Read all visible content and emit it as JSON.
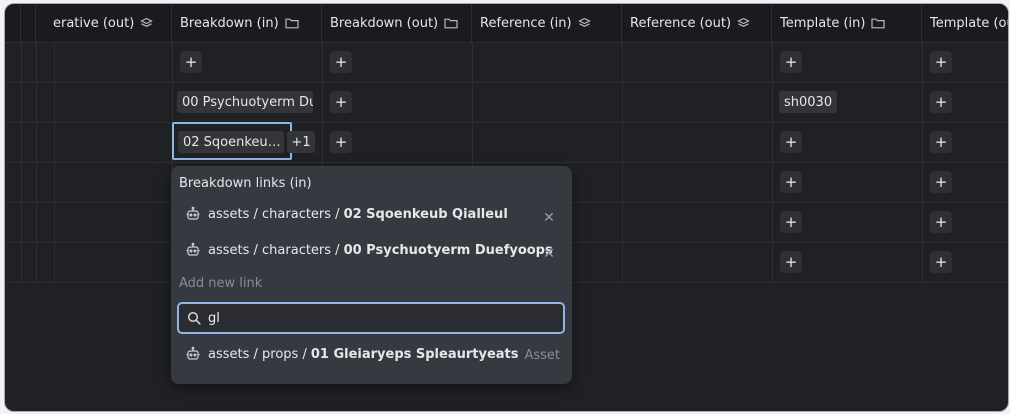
{
  "columns": [
    {
      "label": "erative (out)",
      "icon": "stack-icon"
    },
    {
      "label": "Breakdown (in)",
      "icon": "folder-icon"
    },
    {
      "label": "Breakdown (out)",
      "icon": "folder-icon"
    },
    {
      "label": "Reference (in)",
      "icon": "stack-icon"
    },
    {
      "label": "Reference (out)",
      "icon": "stack-icon"
    },
    {
      "label": "Template (in)",
      "icon": "folder-icon"
    },
    {
      "label": "Template (ou",
      "icon": "none"
    }
  ],
  "cells": {
    "add_symbol": "+",
    "row2_breakdown_in": "00 Psychuotyerm Du",
    "row2_template_in": "sh0030",
    "row3_breakdown_in": "02 Sqoenkeu…",
    "row3_more_count": "+1"
  },
  "popup": {
    "title": "Breakdown links (in)",
    "links": [
      {
        "path": "assets / characters /",
        "name": "02 Sqoenkeub Qialleul",
        "icon": "asset-icon"
      },
      {
        "path": "assets / characters /",
        "name": "00 Psychuotyerm Duefyoops",
        "icon": "asset-icon"
      }
    ],
    "remove_symbol": "✕",
    "add_label": "Add new link",
    "search": {
      "value": "gl",
      "placeholder": ""
    },
    "results": [
      {
        "path": "assets / props /",
        "name": "01 Gleiaryeps Spleaurtyeats",
        "type": "Asset",
        "icon": "asset-icon"
      }
    ]
  }
}
